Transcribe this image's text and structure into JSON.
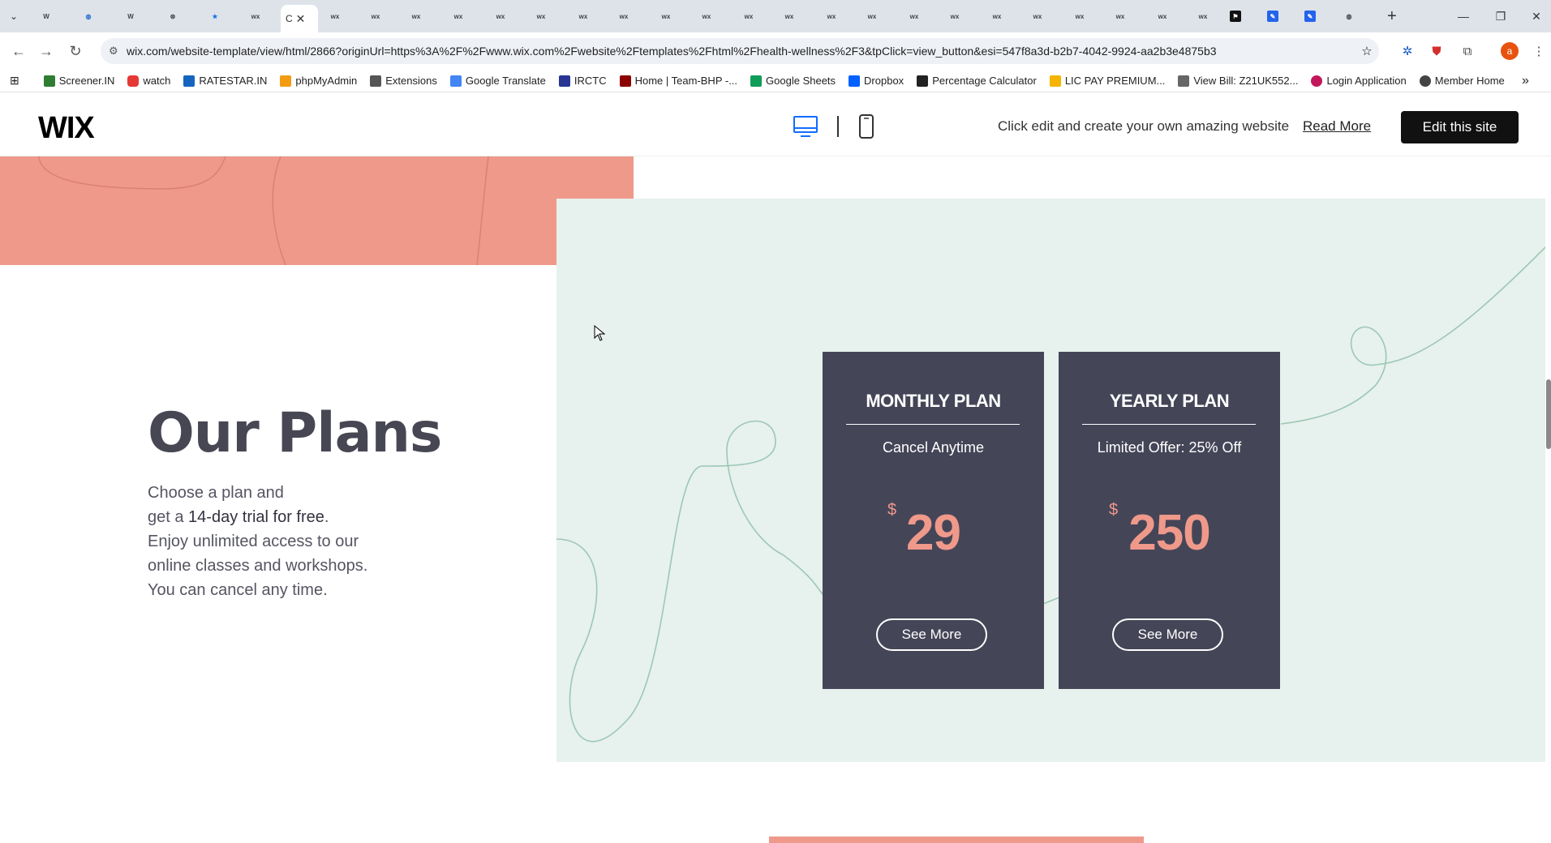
{
  "browser": {
    "url": "wix.com/website-template/view/html/2866?originUrl=https%3A%2F%2Fwww.wix.com%2Fwebsite%2Ftemplates%2Fhtml%2Fhealth-wellness%2F3&tpClick=view_button&esi=547f8a3d-b2b7-4042-9924-aa2b3e4875b3",
    "active_tab_label": "C",
    "bookmarks": [
      {
        "label": "Screener.IN",
        "color": "#2e7d32"
      },
      {
        "label": "watch",
        "color": "#e53935"
      },
      {
        "label": "RATESTAR.IN",
        "color": "#1565c0"
      },
      {
        "label": "phpMyAdmin",
        "color": "#f39c12"
      },
      {
        "label": "Extensions",
        "color": "#555555"
      },
      {
        "label": "Google Translate",
        "color": "#4285f4"
      },
      {
        "label": "IRCTC",
        "color": "#283593"
      },
      {
        "label": "Home | Team-BHP -...",
        "color": "#8b0000"
      },
      {
        "label": "Google Sheets",
        "color": "#0f9d58"
      },
      {
        "label": "Dropbox",
        "color": "#0061fe"
      },
      {
        "label": "Percentage Calculator",
        "color": "#222222"
      },
      {
        "label": "LIC PAY PREMIUM...",
        "color": "#f4b400"
      },
      {
        "label": "View Bill: Z21UK552...",
        "color": "#666666"
      },
      {
        "label": "Login Application",
        "color": "#c2185b"
      },
      {
        "label": "Member Home",
        "color": "#444444"
      }
    ],
    "overflow_glyph": "»"
  },
  "wix_header": {
    "logo": "WIX",
    "tagline": "Click edit and create your own amazing website",
    "read_more": "Read More",
    "edit_button": "Edit this site"
  },
  "plans": {
    "title": "Our Plans",
    "desc_line1": "Choose a plan and",
    "desc_line2_pre": "get a ",
    "desc_line2_bold": "14-day trial for free",
    "desc_line2_post": ".",
    "desc_line3": "Enjoy unlimited access to our",
    "desc_line4": "online classes and workshops.",
    "desc_line5": "You can cancel any time.",
    "cards": [
      {
        "title": "MONTHLY PLAN",
        "subtitle": "Cancel Anytime",
        "currency": "$",
        "price": "29",
        "button": "See More"
      },
      {
        "title": "YEARLY PLAN",
        "subtitle": "Limited Offer: 25% Off",
        "currency": "$",
        "price": "250",
        "button": "See More"
      }
    ]
  },
  "colors": {
    "salmon": "#ef998a",
    "mint": "#e7f1ed",
    "card": "#454558",
    "heading": "#474754"
  }
}
